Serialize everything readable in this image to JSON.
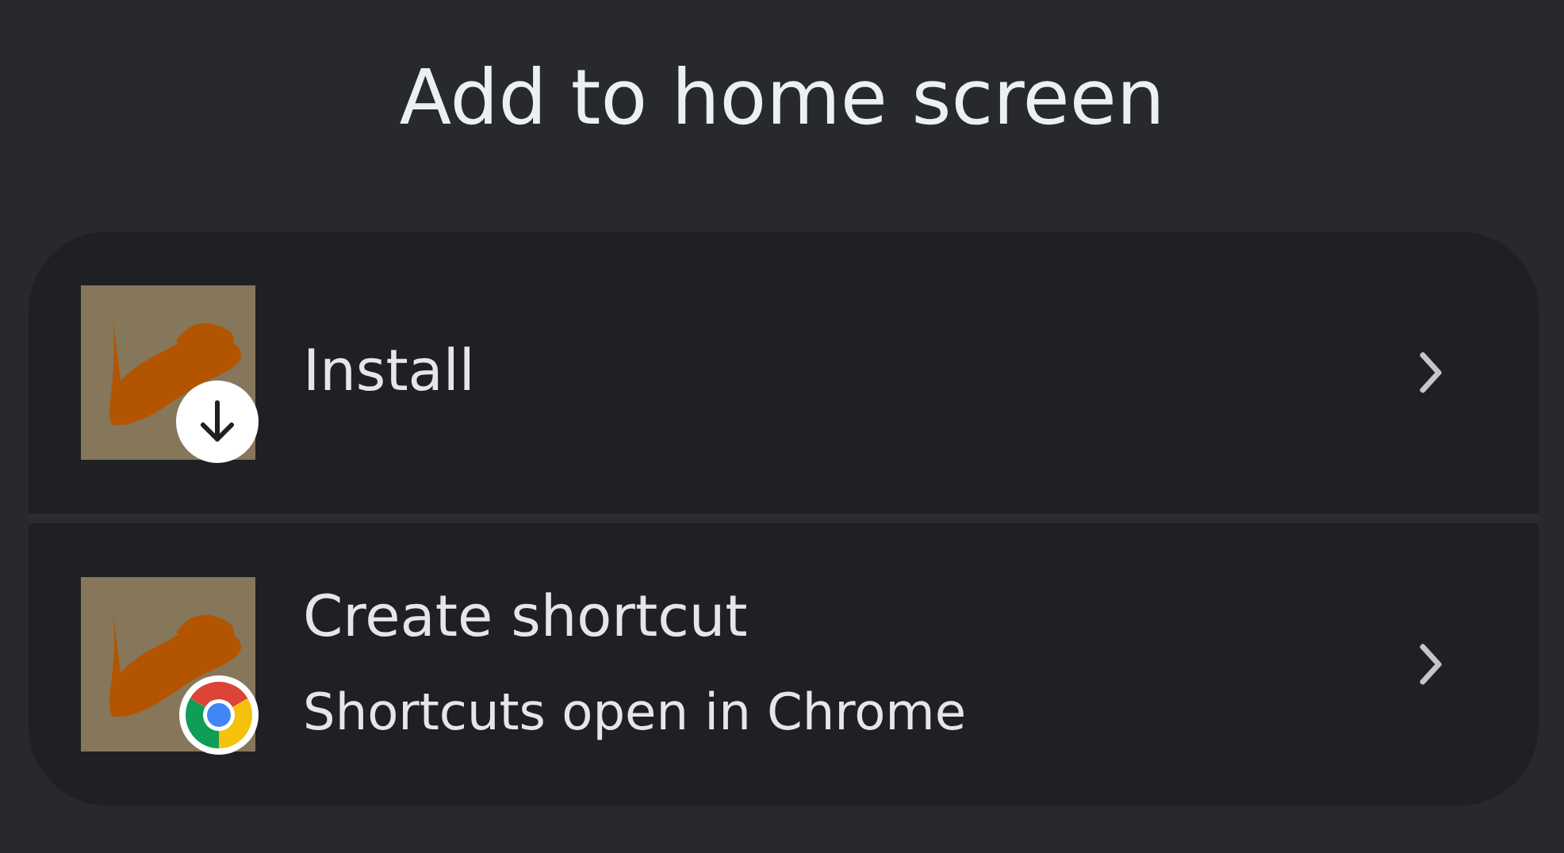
{
  "title": "Add to home screen",
  "options": [
    {
      "label": "Install",
      "kind": "download"
    },
    {
      "label": "Create shortcut",
      "subtitle": "Shortcuts open in Chrome",
      "kind": "chrome"
    }
  ]
}
